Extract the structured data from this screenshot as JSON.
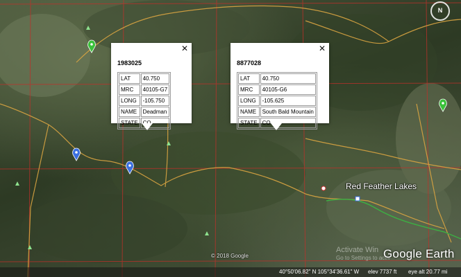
{
  "popups": [
    {
      "id": "1983025",
      "close": "✕",
      "rows": [
        {
          "key": "LAT",
          "value": "40.750"
        },
        {
          "key": "MRC",
          "value": "40105-G7"
        },
        {
          "key": "LONG",
          "value": "-105.750"
        },
        {
          "key": "NAME",
          "value": "Deadman"
        },
        {
          "key": "STATE",
          "value": "CO"
        }
      ]
    },
    {
      "id": "8877028",
      "close": "✕",
      "rows": [
        {
          "key": "LAT",
          "value": "40.750"
        },
        {
          "key": "MRC",
          "value": "40105-G6"
        },
        {
          "key": "LONG",
          "value": "-105.625"
        },
        {
          "key": "NAME",
          "value": "South Bald Mountain"
        },
        {
          "key": "STATE",
          "value": "CO"
        }
      ]
    }
  ],
  "place_label": "Red Feather Lakes",
  "copyright": "© 2018 Google",
  "watermark": {
    "line1": "Activate Win",
    "line2": "Go to Settings to activ"
  },
  "logo": "Google Earth",
  "compass_label": "N",
  "status": {
    "coords": "40°50'06.82\" N   105°34'36.61\" W",
    "elev": "elev  7737 ft",
    "eye": "eye alt  20.77 mi"
  },
  "colors": {
    "road": "#d9a441",
    "grid": "#c0302a",
    "trail": "#3cb043",
    "pin_green": "#3ac13a",
    "pin_blue": "#3b6fe0"
  },
  "icons": [
    "close-icon",
    "map-pin-icon",
    "compass-icon",
    "peak-icon",
    "place-icon"
  ]
}
